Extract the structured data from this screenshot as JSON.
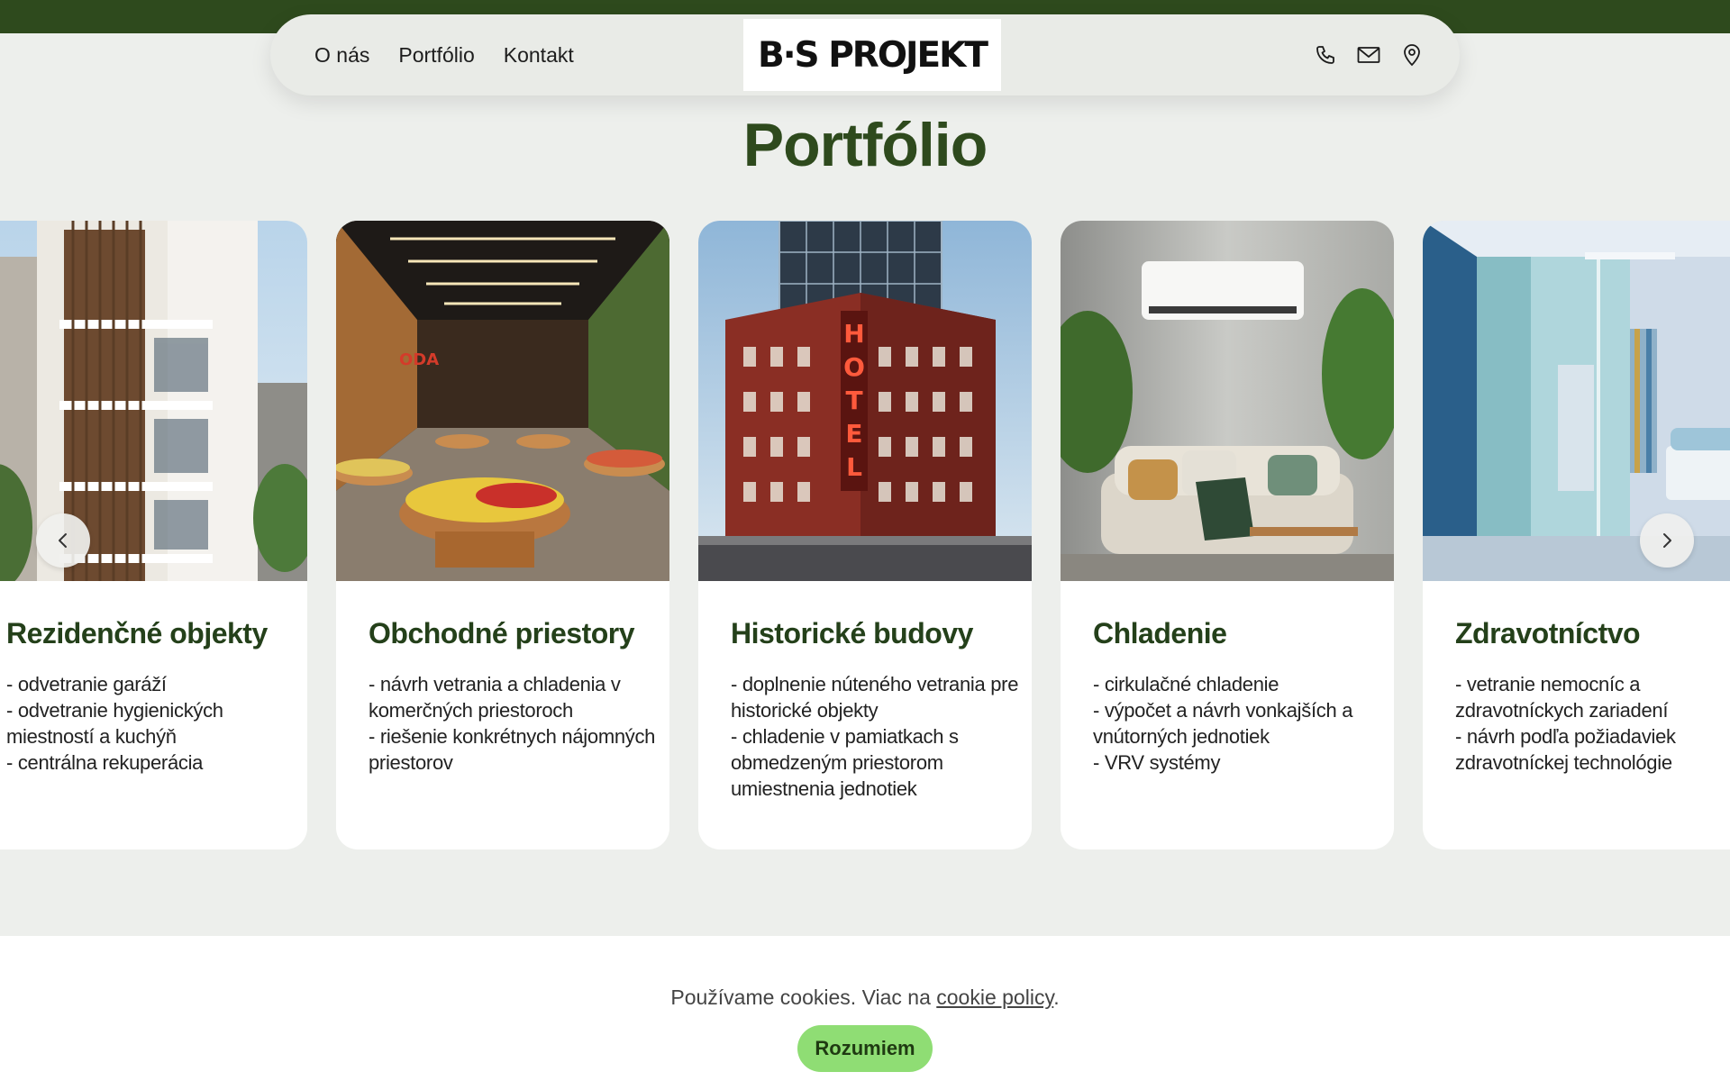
{
  "nav": {
    "links": [
      "O nás",
      "Portfólio",
      "Kontakt"
    ],
    "logo": "B·S PROJEKT",
    "icons": [
      "phone-icon",
      "mail-icon",
      "location-pin-icon"
    ]
  },
  "page_title": "Portfólio",
  "cards": [
    {
      "title": "Rezidenčné objekty",
      "items": [
        "- odvetranie garáží",
        "- odvetranie hygienických miestností a kuchýň",
        "- centrálna rekuperácia"
      ]
    },
    {
      "title": "Obchodné priestory",
      "items": [
        "- návrh vetrania a chladenia v komerčných priestoroch",
        "- riešenie konkrétnych nájomných priestorov"
      ]
    },
    {
      "title": "Historické budovy",
      "items": [
        "- doplnenie núteného vetrania pre historické objekty",
        "- chladenie v pamiatkach s obmedzeným priestorom umiestnenia jednotiek"
      ]
    },
    {
      "title": "Chladenie",
      "items": [
        "- cirkulačné chladenie",
        "- výpočet a návrh vonkajších a vnútorných jednotiek",
        "- VRV systémy"
      ]
    },
    {
      "title": "Zdravotníctvo",
      "items": [
        "- vetranie nemocníc a zdravotníckych zariadení",
        "- návrh podľa požiadaviek zdravotníckej technológie"
      ]
    }
  ],
  "hotel_sign": "HOTEL",
  "cookie": {
    "text_before": "Používame cookies. Viac na ",
    "link": "cookie policy",
    "text_after": ".",
    "button": "Rozumiem"
  },
  "colors": {
    "brand_green": "#2e4a1d",
    "accent_green": "#8fdd74",
    "background": "#edefec"
  }
}
